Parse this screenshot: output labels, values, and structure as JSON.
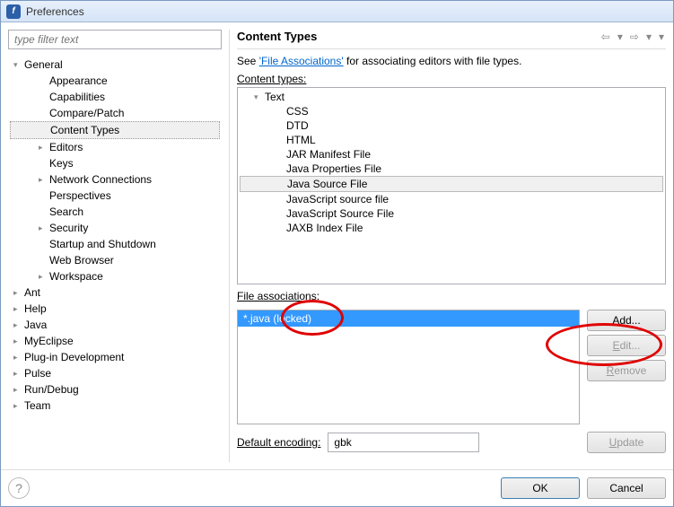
{
  "title": "Preferences",
  "filter_placeholder": "type filter text",
  "nav": [
    {
      "label": "General",
      "level": 0,
      "expanded": true,
      "selected": false,
      "hasChildren": true
    },
    {
      "label": "Appearance",
      "level": 1,
      "selected": false
    },
    {
      "label": "Capabilities",
      "level": 1,
      "selected": false
    },
    {
      "label": "Compare/Patch",
      "level": 1,
      "selected": false
    },
    {
      "label": "Content Types",
      "level": 1,
      "selected": true
    },
    {
      "label": "Editors",
      "level": 1,
      "selected": false,
      "hasChildren": true
    },
    {
      "label": "Keys",
      "level": 1,
      "selected": false
    },
    {
      "label": "Network Connections",
      "level": 1,
      "selected": false,
      "hasChildren": true
    },
    {
      "label": "Perspectives",
      "level": 1,
      "selected": false
    },
    {
      "label": "Search",
      "level": 1,
      "selected": false
    },
    {
      "label": "Security",
      "level": 1,
      "selected": false,
      "hasChildren": true
    },
    {
      "label": "Startup and Shutdown",
      "level": 1,
      "selected": false
    },
    {
      "label": "Web Browser",
      "level": 1,
      "selected": false
    },
    {
      "label": "Workspace",
      "level": 1,
      "selected": false,
      "hasChildren": true
    },
    {
      "label": "Ant",
      "level": 0,
      "selected": false,
      "hasChildren": true
    },
    {
      "label": "Help",
      "level": 0,
      "selected": false,
      "hasChildren": true
    },
    {
      "label": "Java",
      "level": 0,
      "selected": false,
      "hasChildren": true
    },
    {
      "label": "MyEclipse",
      "level": 0,
      "selected": false,
      "hasChildren": true
    },
    {
      "label": "Plug-in Development",
      "level": 0,
      "selected": false,
      "hasChildren": true
    },
    {
      "label": "Pulse",
      "level": 0,
      "selected": false,
      "hasChildren": true
    },
    {
      "label": "Run/Debug",
      "level": 0,
      "selected": false,
      "hasChildren": true
    },
    {
      "label": "Team",
      "level": 0,
      "selected": false,
      "hasChildren": true
    }
  ],
  "page": {
    "heading": "Content Types",
    "intro_pre": "See ",
    "intro_link": "'File Associations'",
    "intro_post": " for associating editors with file types.",
    "content_types_label": "Content types:",
    "content_types": [
      {
        "label": "Text",
        "level": 0,
        "expanded": true
      },
      {
        "label": "CSS",
        "level": 1
      },
      {
        "label": "DTD",
        "level": 1
      },
      {
        "label": "HTML",
        "level": 1
      },
      {
        "label": "JAR Manifest File",
        "level": 1
      },
      {
        "label": "Java Properties File",
        "level": 1
      },
      {
        "label": "Java Source File",
        "level": 1,
        "selected": true
      },
      {
        "label": "JavaScript source file",
        "level": 1
      },
      {
        "label": "JavaScript Source File",
        "level": 1
      },
      {
        "label": "JAXB Index File",
        "level": 1
      }
    ],
    "file_assoc_label": "File associations:",
    "file_assoc": [
      {
        "label": "*.java (locked)",
        "selected": true
      }
    ],
    "buttons": {
      "add": "Add...",
      "edit": "Edit...",
      "remove": "Remove",
      "update": "Update"
    },
    "encoding_label": "Default encoding:",
    "encoding_value": "gbk"
  },
  "footer": {
    "ok": "OK",
    "cancel": "Cancel"
  }
}
